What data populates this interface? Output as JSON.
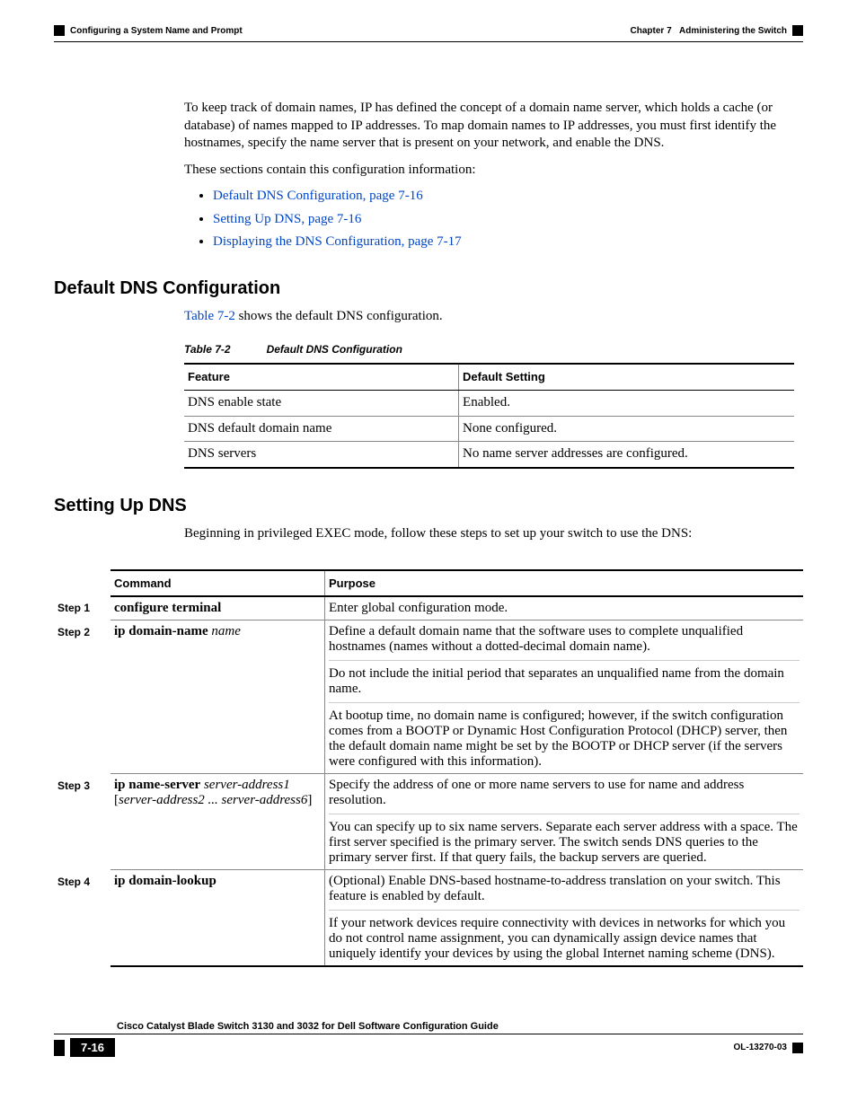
{
  "header": {
    "left": "Configuring a System Name and Prompt",
    "right_prefix": "Chapter 7",
    "right_title": "Administering the Switch"
  },
  "intro": {
    "p1": "To keep track of domain names, IP has defined the concept of a domain name server, which holds a cache (or database) of names mapped to IP addresses. To map domain names to IP addresses, you must first identify the hostnames, specify the name server that is present on your network, and enable the DNS.",
    "p2": "These sections contain this configuration information:",
    "bullets": [
      "Default DNS Configuration, page 7-16",
      "Setting Up DNS, page 7-16",
      "Displaying the DNS Configuration, page 7-17"
    ]
  },
  "section1": {
    "heading": "Default DNS Configuration",
    "lead_link": "Table 7-2",
    "lead_rest": " shows the default DNS configuration.",
    "table_caption_num": "Table 7-2",
    "table_caption_title": "Default DNS Configuration",
    "th1": "Feature",
    "th2": "Default Setting",
    "rows": [
      {
        "f": "DNS enable state",
        "d": "Enabled."
      },
      {
        "f": "DNS default domain name",
        "d": "None configured."
      },
      {
        "f": "DNS servers",
        "d": "No name server addresses are configured."
      }
    ]
  },
  "section2": {
    "heading": "Setting Up DNS",
    "lead": "Beginning in privileged EXEC mode, follow these steps to set up your switch to use the DNS:",
    "th_cmd": "Command",
    "th_purpose": "Purpose",
    "steps": {
      "s1": {
        "label": "Step 1",
        "cmd_b": "configure terminal",
        "p1": "Enter global configuration mode."
      },
      "s2": {
        "label": "Step 2",
        "cmd_b": "ip domain-name",
        "cmd_i": " name",
        "p1": "Define a default domain name that the software uses to complete unqualified hostnames (names without a dotted-decimal domain name).",
        "p2": "Do not include the initial period that separates an unqualified name from the domain name.",
        "p3": "At bootup time, no domain name is configured; however, if the switch configuration comes from a BOOTP or Dynamic Host Configuration Protocol (DHCP) server, then the default domain name might be set by the BOOTP or DHCP server (if the servers were configured with this information)."
      },
      "s3": {
        "label": "Step 3",
        "cmd_b": "ip name-server",
        "cmd_i1": " server-address1",
        "cmd_br1": "[",
        "cmd_i2": "server-address2 ... server-address6",
        "cmd_br2": "]",
        "p1": "Specify the address of one or more name servers to use for name and address resolution.",
        "p2": "You can specify up to six name servers. Separate each server address with a space. The first server specified is the primary server. The switch sends DNS queries to the primary server first. If that query fails, the backup servers are queried."
      },
      "s4": {
        "label": "Step 4",
        "cmd_b": "ip domain-lookup",
        "p1": "(Optional) Enable DNS-based hostname-to-address translation on your switch. This feature is enabled by default.",
        "p2": "If your network devices require connectivity with devices in networks for which you do not control name assignment, you can dynamically assign device names that uniquely identify your devices by using the global Internet naming scheme (DNS)."
      }
    }
  },
  "footer": {
    "guide": "Cisco Catalyst Blade Switch 3130 and 3032 for Dell Software Configuration Guide",
    "page": "7-16",
    "docnum": "OL-13270-03"
  }
}
